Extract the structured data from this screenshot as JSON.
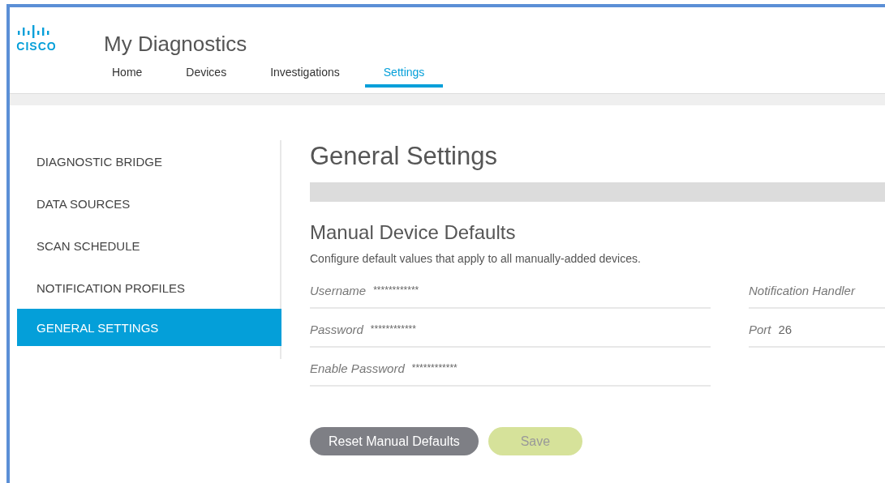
{
  "app": {
    "title": "My Diagnostics"
  },
  "logo": {
    "text": "CISCO"
  },
  "tabs": [
    {
      "label": "Home",
      "selected": false
    },
    {
      "label": "Devices",
      "selected": false
    },
    {
      "label": "Investigations",
      "selected": false
    },
    {
      "label": "Settings",
      "selected": true
    }
  ],
  "sidebar": {
    "items": [
      {
        "label": "DIAGNOSTIC BRIDGE",
        "selected": false
      },
      {
        "label": "DATA SOURCES",
        "selected": false
      },
      {
        "label": "SCAN SCHEDULE",
        "selected": false
      },
      {
        "label": "NOTIFICATION PROFILES",
        "selected": false
      },
      {
        "label": "GENERAL SETTINGS",
        "selected": true
      }
    ]
  },
  "page": {
    "title": "General Settings",
    "section_title": "Manual Device Defaults",
    "description": "Configure default values that apply to all manually-added devices."
  },
  "fields_left": [
    {
      "label": "Username",
      "value": "************"
    },
    {
      "label": "Password",
      "value": "************"
    },
    {
      "label": "Enable Password",
      "value": "************"
    }
  ],
  "fields_right": [
    {
      "label": "Notification Handler"
    },
    {
      "label": "Port",
      "value": "26"
    }
  ],
  "buttons": [
    {
      "label": "Reset Manual Defaults",
      "kind": "secondary",
      "disabled": false
    },
    {
      "label": "Save",
      "kind": "primary",
      "disabled": true
    }
  ]
}
